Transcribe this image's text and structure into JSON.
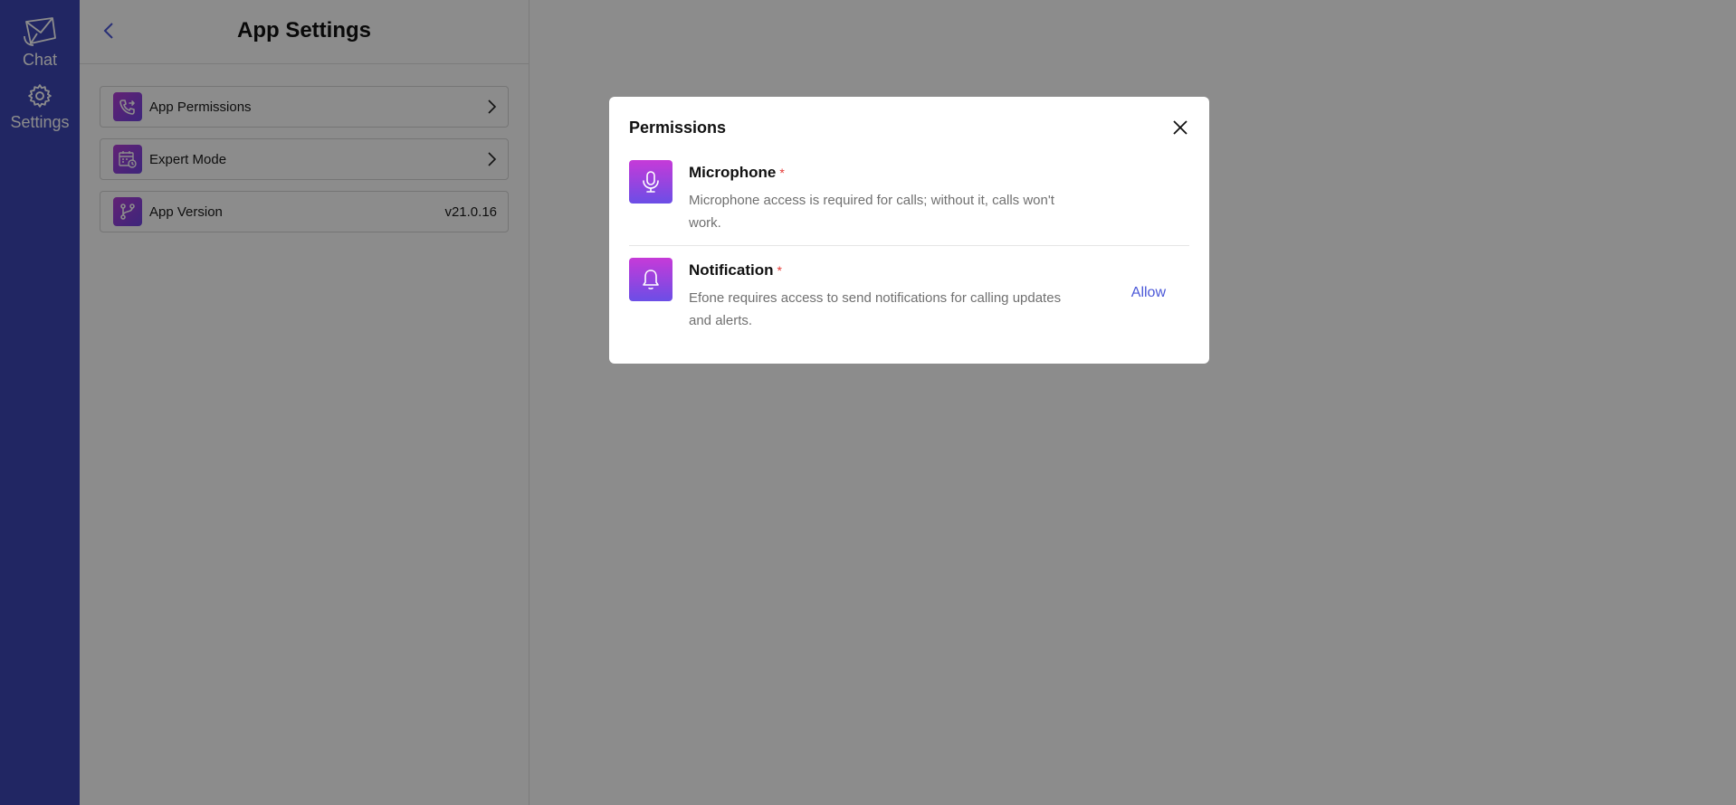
{
  "rail": {
    "chat_label": "Chat",
    "settings_label": "Settings",
    "bg_color": "#3d45b5"
  },
  "panel": {
    "title": "App Settings",
    "items": [
      {
        "label": "App Permissions",
        "icon": "phone-transfer-icon"
      },
      {
        "label": "Expert Mode",
        "icon": "calendar-clock-icon"
      },
      {
        "label": "App Version",
        "value": "v21.0.16",
        "icon": "branch-icon"
      }
    ]
  },
  "modal": {
    "title": "Permissions",
    "permissions": [
      {
        "name": "Microphone",
        "required_mark": "*",
        "description": "Microphone access is required for calls; without it, calls won't work.",
        "icon": "microphone-icon"
      },
      {
        "name": "Notification",
        "required_mark": "*",
        "description": "Efone requires access to send notifications for calling updates and alerts.",
        "action_label": "Allow",
        "icon": "bell-icon"
      }
    ]
  },
  "colors": {
    "accent": "#4a57d8",
    "icon_gradient_start": "#c63ad8",
    "icon_gradient_end": "#6b4ee6",
    "required": "#e53935"
  }
}
